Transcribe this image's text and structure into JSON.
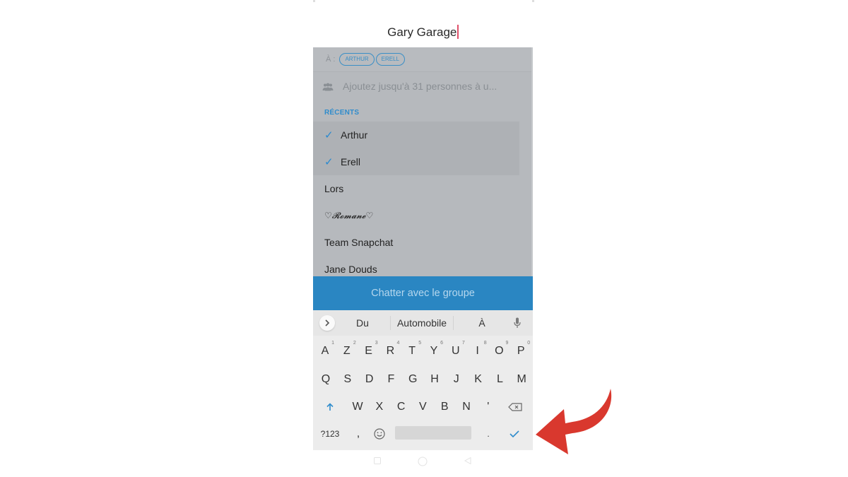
{
  "group_name": {
    "value": "Gary Garage"
  },
  "recipients": {
    "label": "À :",
    "chips": [
      "ARTHUR",
      "ERELL"
    ]
  },
  "add_field": {
    "icon": "group-icon",
    "placeholder": "Ajoutez jusqu'à 31 personnes à u..."
  },
  "section": {
    "title": "RÉCENTS"
  },
  "contacts": [
    {
      "name": "Arthur",
      "selected": true
    },
    {
      "name": "Erell",
      "selected": true
    },
    {
      "name": "Lors",
      "selected": false
    },
    {
      "name": "♡𝓡𝓸𝓶𝓪𝓷𝓮♡",
      "selected": false
    },
    {
      "name": "Team Snapchat",
      "selected": false
    },
    {
      "name": "Jane Douds",
      "selected": false
    }
  ],
  "chat_button": {
    "label": "Chatter avec le groupe"
  },
  "keyboard": {
    "suggestions": [
      "Du",
      "Automobile",
      "À"
    ],
    "expand_icon": "chevron-right-icon",
    "mic_icon": "microphone-icon",
    "row1": [
      {
        "k": "A",
        "n": "1"
      },
      {
        "k": "Z",
        "n": "2"
      },
      {
        "k": "E",
        "n": "3"
      },
      {
        "k": "R",
        "n": "4"
      },
      {
        "k": "T",
        "n": "5"
      },
      {
        "k": "Y",
        "n": "6"
      },
      {
        "k": "U",
        "n": "7"
      },
      {
        "k": "I",
        "n": "8"
      },
      {
        "k": "O",
        "n": "9"
      },
      {
        "k": "P",
        "n": "0"
      }
    ],
    "row2": [
      "Q",
      "S",
      "D",
      "F",
      "G",
      "H",
      "J",
      "K",
      "L",
      "M"
    ],
    "row3": [
      "W",
      "X",
      "C",
      "V",
      "B",
      "N",
      "'"
    ],
    "shift_icon": "shift-arrow-icon",
    "backspace_icon": "backspace-icon",
    "symbols_label": "?123",
    "comma": ",",
    "emoji_icon": "emoji-icon",
    "period": ".",
    "enter_icon": "checkmark-icon"
  },
  "colors": {
    "accent": "#2a86c2",
    "check": "#2a8ad0",
    "annotation_arrow": "#d9382e"
  }
}
